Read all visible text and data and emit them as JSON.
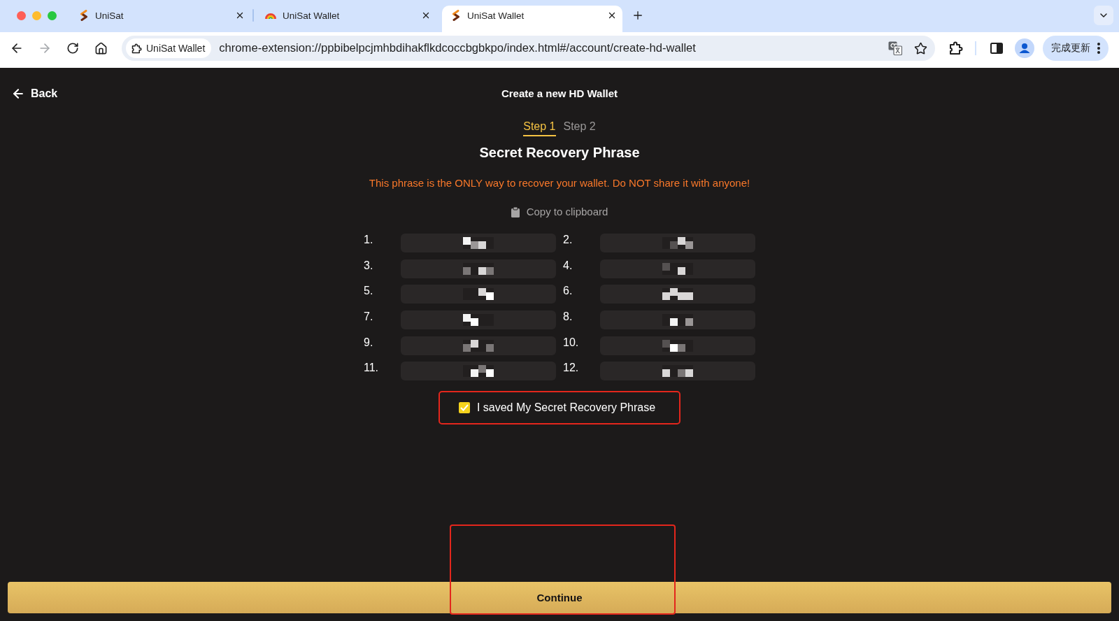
{
  "browser": {
    "tabs": [
      {
        "kind": "unisat",
        "title": "UniSat",
        "selected": false
      },
      {
        "kind": "rainbow",
        "title": "UniSat Wallet",
        "selected": false
      },
      {
        "kind": "unisat",
        "title": "UniSat Wallet",
        "selected": true
      }
    ],
    "forward_button": {
      "disabled": true
    },
    "address_bar": {
      "site_chip": "UniSat Wallet",
      "url": "chrome-extension://ppbibelpcjmhbdihakflkdcoccbgbkpo/index.html#/account/create-hd-wallet"
    },
    "update_button": "完成更新"
  },
  "page": {
    "back": "Back",
    "title": "Create a new HD Wallet",
    "steps": [
      {
        "label": "Step 1",
        "selected": true
      },
      {
        "label": "Step 2",
        "selected": false
      }
    ],
    "heading": "Secret Recovery Phrase",
    "warning": "This phrase is the ONLY way to recover your wallet. Do NOT share it with anyone!",
    "copy_link": "Copy to clipboard",
    "words": [
      {
        "number": "1.",
        "masked": true
      },
      {
        "number": "2.",
        "masked": true
      },
      {
        "number": "3.",
        "masked": true
      },
      {
        "number": "4.",
        "masked": true
      },
      {
        "number": "5.",
        "masked": true
      },
      {
        "number": "6.",
        "masked": true
      },
      {
        "number": "7.",
        "masked": true
      },
      {
        "number": "8.",
        "masked": true
      },
      {
        "number": "9.",
        "masked": true
      },
      {
        "number": "10.",
        "masked": true
      },
      {
        "number": "11.",
        "masked": true
      },
      {
        "number": "12.",
        "masked": true
      }
    ],
    "confirm": {
      "label": "I saved My Secret Recovery Phrase",
      "checked": true,
      "highlighted": true
    },
    "continue_button": {
      "label": "Continue",
      "highlighted": true
    }
  }
}
